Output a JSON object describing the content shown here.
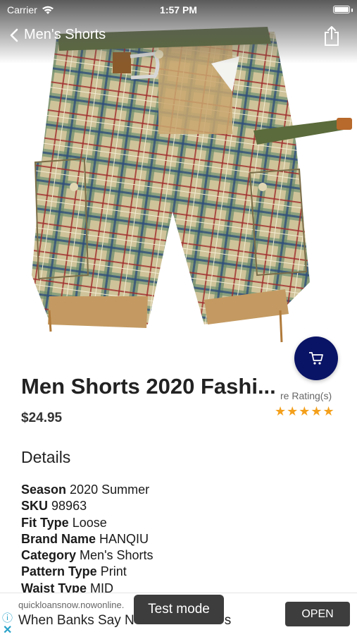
{
  "status_bar": {
    "carrier": "Carrier",
    "time": "1:57 PM"
  },
  "nav": {
    "title": "Men's Shorts",
    "back_icon": "chevron-left-icon",
    "share_icon": "share-icon"
  },
  "product": {
    "title": "Men Shorts 2020 Fashi...",
    "price": "$24.95",
    "rating_text": "re Rating(s)",
    "stars": "★★★★★",
    "rating_value": 5,
    "details_heading": "Details",
    "specs": [
      {
        "label": "Season",
        "value": "2020 Summer"
      },
      {
        "label": "SKU",
        "value": "98963"
      },
      {
        "label": "Fit Type",
        "value": "Loose"
      },
      {
        "label": "Brand Name",
        "value": "HANQIU"
      },
      {
        "label": "Category",
        "value": "Men's Shorts"
      },
      {
        "label": "Pattern Type",
        "value": "Print"
      },
      {
        "label": "Waist Type",
        "value": "MID"
      }
    ]
  },
  "ad": {
    "url": "quickloansnow.nowonline.",
    "headline": "When Banks Say N",
    "headline_tail": "s",
    "open_label": "OPEN",
    "test_mode_label": "Test mode"
  },
  "colors": {
    "cart_button": "#0a1466",
    "star": "#f4a01c",
    "ad_button": "#3d3d3d"
  }
}
